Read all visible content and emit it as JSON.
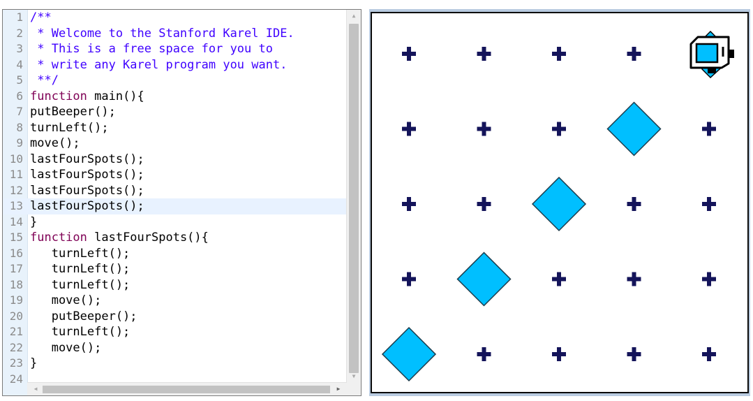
{
  "editor": {
    "lines": [
      {
        "num": "1",
        "text": "/**",
        "type": "comment"
      },
      {
        "num": "2",
        "text": " * Welcome to the Stanford Karel IDE.",
        "type": "comment"
      },
      {
        "num": "3",
        "text": " * This is a free space for you to",
        "type": "comment"
      },
      {
        "num": "4",
        "text": " * write any Karel program you want.",
        "type": "comment"
      },
      {
        "num": "5",
        "text": " **/",
        "type": "comment"
      },
      {
        "num": "6",
        "text": "function main(){",
        "type": "function"
      },
      {
        "num": "7",
        "text": "putBeeper();",
        "type": "plain"
      },
      {
        "num": "8",
        "text": "turnLeft();",
        "type": "plain"
      },
      {
        "num": "9",
        "text": "move();",
        "type": "plain"
      },
      {
        "num": "10",
        "text": "lastFourSpots();",
        "type": "plain"
      },
      {
        "num": "11",
        "text": "lastFourSpots();",
        "type": "plain"
      },
      {
        "num": "12",
        "text": "lastFourSpots();",
        "type": "plain"
      },
      {
        "num": "13",
        "text": "lastFourSpots();",
        "type": "plain",
        "active": true
      },
      {
        "num": "14",
        "text": "}",
        "type": "plain"
      },
      {
        "num": "15",
        "text": "function lastFourSpots(){",
        "type": "function"
      },
      {
        "num": "16",
        "text": "   turnLeft();",
        "type": "plain"
      },
      {
        "num": "17",
        "text": "   turnLeft();",
        "type": "plain"
      },
      {
        "num": "18",
        "text": "   turnLeft();",
        "type": "plain"
      },
      {
        "num": "19",
        "text": "   move();",
        "type": "plain"
      },
      {
        "num": "20",
        "text": "   putBeeper();",
        "type": "plain"
      },
      {
        "num": "21",
        "text": "   turnLeft();",
        "type": "plain"
      },
      {
        "num": "22",
        "text": "   move();",
        "type": "plain"
      },
      {
        "num": "23",
        "text": "}",
        "type": "plain"
      },
      {
        "num": "24",
        "text": "",
        "type": "plain"
      }
    ],
    "scroll_up_glyph": "▲",
    "scroll_down_glyph": "▼",
    "scroll_left_glyph": "◀",
    "scroll_right_glyph": "▶"
  },
  "world": {
    "columns": 5,
    "rows": 5,
    "beepers": [
      {
        "col": 1,
        "row": 1
      },
      {
        "col": 2,
        "row": 2
      },
      {
        "col": 3,
        "row": 3
      },
      {
        "col": 4,
        "row": 4
      }
    ],
    "karel": {
      "col": 5,
      "row": 5,
      "facing": "north",
      "icon": "karel-robot-icon"
    },
    "colors": {
      "corner_marker": "#14145a",
      "beeper_fill": "#00bfff",
      "beeper_stroke": "#1a3a4a",
      "karel_screen": "#00bfff",
      "frame": "#b9cbe0"
    }
  }
}
